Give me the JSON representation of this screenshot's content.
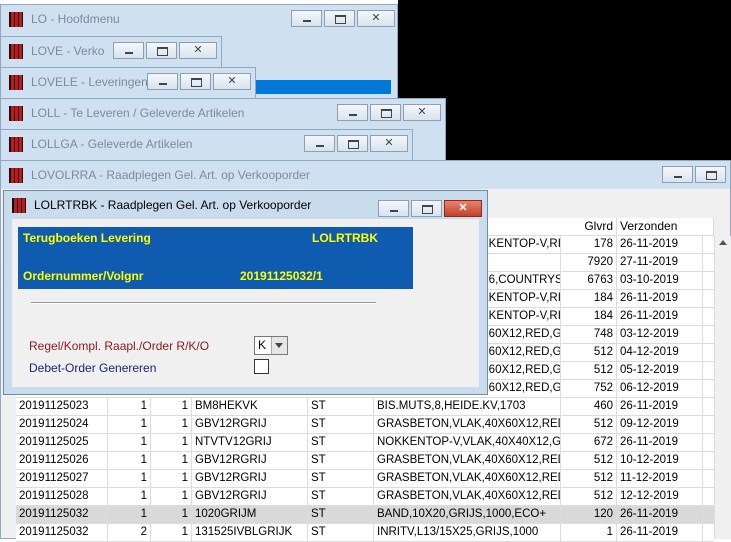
{
  "windows": {
    "lo": {
      "title": "LO - Hoofdmenu"
    },
    "love": {
      "title": "LOVE - Verko"
    },
    "lovele": {
      "title": "LOVELE - Leveringen"
    },
    "loll": {
      "title": "LOLL - Te Leveren / Geleverde Artikelen"
    },
    "lollga": {
      "title": "LOLLGA - Geleverde Artikelen"
    },
    "lovolrra": {
      "title": "LOVOLRRA - Raadplegen Gel. Art. op Verkooporder"
    }
  },
  "grid": {
    "headers": {
      "glvrd": "Glvrd",
      "verzonden": "Verzonden"
    },
    "partial_rows": [
      {
        "desc": "KKENTOP-V,RI",
        "glvrd": "178",
        "date": "26-11-2019"
      },
      {
        "desc": "",
        "glvrd": "7920",
        "date": "27-11-2019"
      },
      {
        "desc": "X6,COUNTRYS",
        "glvrd": "6763",
        "date": "03-10-2019"
      },
      {
        "desc": "KKENTOP-V,RI",
        "glvrd": "184",
        "date": "26-11-2019"
      },
      {
        "desc": "KKENTOP-V,RI",
        "glvrd": "184",
        "date": "26-11-2019"
      },
      {
        "desc": "X60X12,RED,G",
        "glvrd": "748",
        "date": "03-12-2019"
      },
      {
        "desc": "X60X12,RED,G",
        "glvrd": "512",
        "date": "04-12-2019"
      },
      {
        "desc": "X60X12,RED,G",
        "glvrd": "512",
        "date": "05-12-2019"
      },
      {
        "desc": "X60X12,RED,G",
        "glvrd": "752",
        "date": "06-12-2019"
      }
    ],
    "rows": [
      {
        "order": "20191125023",
        "a": "1",
        "b": "1",
        "art": "BM8HEKVK",
        "unit": "ST",
        "desc": "BIS.MUTS,8,HEIDE.KV,1703",
        "glvrd": "460",
        "date": "26-11-2019"
      },
      {
        "order": "20191125024",
        "a": "1",
        "b": "1",
        "art": "GBV12RGRIJ",
        "unit": "ST",
        "desc": "GRASBETON,VLAK,40X60X12,RED,G",
        "glvrd": "512",
        "date": "09-12-2019"
      },
      {
        "order": "20191125025",
        "a": "1",
        "b": "1",
        "art": "NTVTV12GRIJ",
        "unit": "ST",
        "desc": "NOKKENTOP-V,VLAK,40X40X12,GRIJ",
        "glvrd": "672",
        "date": "26-11-2019"
      },
      {
        "order": "20191125026",
        "a": "1",
        "b": "1",
        "art": "GBV12RGRIJ",
        "unit": "ST",
        "desc": "GRASBETON,VLAK,40X60X12,RED,G",
        "glvrd": "512",
        "date": "10-12-2019"
      },
      {
        "order": "20191125027",
        "a": "1",
        "b": "1",
        "art": "GBV12RGRIJ",
        "unit": "ST",
        "desc": "GRASBETON,VLAK,40X60X12,RED,G",
        "glvrd": "512",
        "date": "11-12-2019"
      },
      {
        "order": "20191125028",
        "a": "1",
        "b": "1",
        "art": "GBV12RGRIJ",
        "unit": "ST",
        "desc": "GRASBETON,VLAK,40X60X12,RED,G",
        "glvrd": "512",
        "date": "12-12-2019"
      },
      {
        "order": "20191125032",
        "a": "1",
        "b": "1",
        "art": "1020GRIJM",
        "unit": "ST",
        "desc": "BAND,10X20,GRIJS,1000,ECO+",
        "glvrd": "120",
        "date": "26-11-2019",
        "selected": true
      },
      {
        "order": "20191125032",
        "a": "2",
        "b": "1",
        "art": "131525IVBLGRIJK",
        "unit": "ST",
        "desc": "INRITV,L13/15X25,GRIJS,1000",
        "glvrd": "1",
        "date": "26-11-2019"
      }
    ]
  },
  "dialog": {
    "title": "LOLRTRBK - Raadplegen Gel. Art. op Verkooporder",
    "header": {
      "caption": "Terugboeken Levering",
      "code": "LOLRTRBK",
      "order_label": "Ordernummer/Volgnr",
      "order_value": "20191125032/1"
    },
    "field1_label": "Regel/Kompl. Raapl./Order R/K/O",
    "field1_value": "K",
    "field2_label": "Debet-Order Genereren"
  },
  "colors": {
    "header_bg": "#0f5bb0",
    "header_text": "#ffff00",
    "label1": "#8b1a1a",
    "label2": "#1a237e"
  }
}
